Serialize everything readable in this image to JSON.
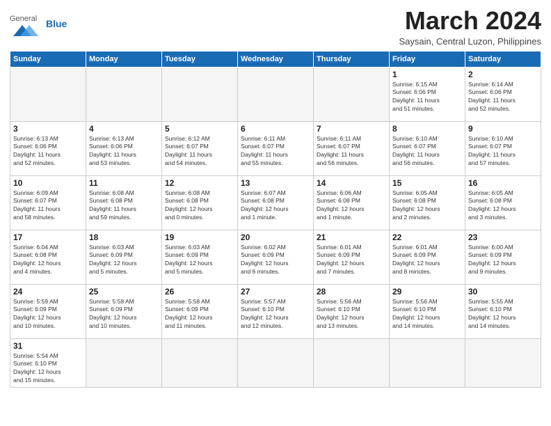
{
  "header": {
    "logo_general": "General",
    "logo_blue": "Blue",
    "month_title": "March 2024",
    "subtitle": "Saysain, Central Luzon, Philippines"
  },
  "weekdays": [
    "Sunday",
    "Monday",
    "Tuesday",
    "Wednesday",
    "Thursday",
    "Friday",
    "Saturday"
  ],
  "weeks": [
    [
      {
        "day": "",
        "info": ""
      },
      {
        "day": "",
        "info": ""
      },
      {
        "day": "",
        "info": ""
      },
      {
        "day": "",
        "info": ""
      },
      {
        "day": "",
        "info": ""
      },
      {
        "day": "1",
        "info": "Sunrise: 6:15 AM\nSunset: 6:06 PM\nDaylight: 11 hours\nand 51 minutes."
      },
      {
        "day": "2",
        "info": "Sunrise: 6:14 AM\nSunset: 6:06 PM\nDaylight: 11 hours\nand 52 minutes."
      }
    ],
    [
      {
        "day": "3",
        "info": "Sunrise: 6:13 AM\nSunset: 6:06 PM\nDaylight: 11 hours\nand 52 minutes."
      },
      {
        "day": "4",
        "info": "Sunrise: 6:13 AM\nSunset: 6:06 PM\nDaylight: 11 hours\nand 53 minutes."
      },
      {
        "day": "5",
        "info": "Sunrise: 6:12 AM\nSunset: 6:07 PM\nDaylight: 11 hours\nand 54 minutes."
      },
      {
        "day": "6",
        "info": "Sunrise: 6:11 AM\nSunset: 6:07 PM\nDaylight: 11 hours\nand 55 minutes."
      },
      {
        "day": "7",
        "info": "Sunrise: 6:11 AM\nSunset: 6:07 PM\nDaylight: 11 hours\nand 56 minutes."
      },
      {
        "day": "8",
        "info": "Sunrise: 6:10 AM\nSunset: 6:07 PM\nDaylight: 11 hours\nand 56 minutes."
      },
      {
        "day": "9",
        "info": "Sunrise: 6:10 AM\nSunset: 6:07 PM\nDaylight: 11 hours\nand 57 minutes."
      }
    ],
    [
      {
        "day": "10",
        "info": "Sunrise: 6:09 AM\nSunset: 6:07 PM\nDaylight: 11 hours\nand 58 minutes."
      },
      {
        "day": "11",
        "info": "Sunrise: 6:08 AM\nSunset: 6:08 PM\nDaylight: 11 hours\nand 59 minutes."
      },
      {
        "day": "12",
        "info": "Sunrise: 6:08 AM\nSunset: 6:08 PM\nDaylight: 12 hours\nand 0 minutes."
      },
      {
        "day": "13",
        "info": "Sunrise: 6:07 AM\nSunset: 6:08 PM\nDaylight: 12 hours\nand 1 minute."
      },
      {
        "day": "14",
        "info": "Sunrise: 6:06 AM\nSunset: 6:08 PM\nDaylight: 12 hours\nand 1 minute."
      },
      {
        "day": "15",
        "info": "Sunrise: 6:05 AM\nSunset: 6:08 PM\nDaylight: 12 hours\nand 2 minutes."
      },
      {
        "day": "16",
        "info": "Sunrise: 6:05 AM\nSunset: 6:08 PM\nDaylight: 12 hours\nand 3 minutes."
      }
    ],
    [
      {
        "day": "17",
        "info": "Sunrise: 6:04 AM\nSunset: 6:08 PM\nDaylight: 12 hours\nand 4 minutes."
      },
      {
        "day": "18",
        "info": "Sunrise: 6:03 AM\nSunset: 6:09 PM\nDaylight: 12 hours\nand 5 minutes."
      },
      {
        "day": "19",
        "info": "Sunrise: 6:03 AM\nSunset: 6:09 PM\nDaylight: 12 hours\nand 5 minutes."
      },
      {
        "day": "20",
        "info": "Sunrise: 6:02 AM\nSunset: 6:09 PM\nDaylight: 12 hours\nand 6 minutes."
      },
      {
        "day": "21",
        "info": "Sunrise: 6:01 AM\nSunset: 6:09 PM\nDaylight: 12 hours\nand 7 minutes."
      },
      {
        "day": "22",
        "info": "Sunrise: 6:01 AM\nSunset: 6:09 PM\nDaylight: 12 hours\nand 8 minutes."
      },
      {
        "day": "23",
        "info": "Sunrise: 6:00 AM\nSunset: 6:09 PM\nDaylight: 12 hours\nand 9 minutes."
      }
    ],
    [
      {
        "day": "24",
        "info": "Sunrise: 5:59 AM\nSunset: 6:09 PM\nDaylight: 12 hours\nand 10 minutes."
      },
      {
        "day": "25",
        "info": "Sunrise: 5:58 AM\nSunset: 6:09 PM\nDaylight: 12 hours\nand 10 minutes."
      },
      {
        "day": "26",
        "info": "Sunrise: 5:58 AM\nSunset: 6:09 PM\nDaylight: 12 hours\nand 11 minutes."
      },
      {
        "day": "27",
        "info": "Sunrise: 5:57 AM\nSunset: 6:10 PM\nDaylight: 12 hours\nand 12 minutes."
      },
      {
        "day": "28",
        "info": "Sunrise: 5:56 AM\nSunset: 6:10 PM\nDaylight: 12 hours\nand 13 minutes."
      },
      {
        "day": "29",
        "info": "Sunrise: 5:56 AM\nSunset: 6:10 PM\nDaylight: 12 hours\nand 14 minutes."
      },
      {
        "day": "30",
        "info": "Sunrise: 5:55 AM\nSunset: 6:10 PM\nDaylight: 12 hours\nand 14 minutes."
      }
    ],
    [
      {
        "day": "31",
        "info": "Sunrise: 5:54 AM\nSunset: 6:10 PM\nDaylight: 12 hours\nand 15 minutes."
      },
      {
        "day": "",
        "info": ""
      },
      {
        "day": "",
        "info": ""
      },
      {
        "day": "",
        "info": ""
      },
      {
        "day": "",
        "info": ""
      },
      {
        "day": "",
        "info": ""
      },
      {
        "day": "",
        "info": ""
      }
    ]
  ]
}
